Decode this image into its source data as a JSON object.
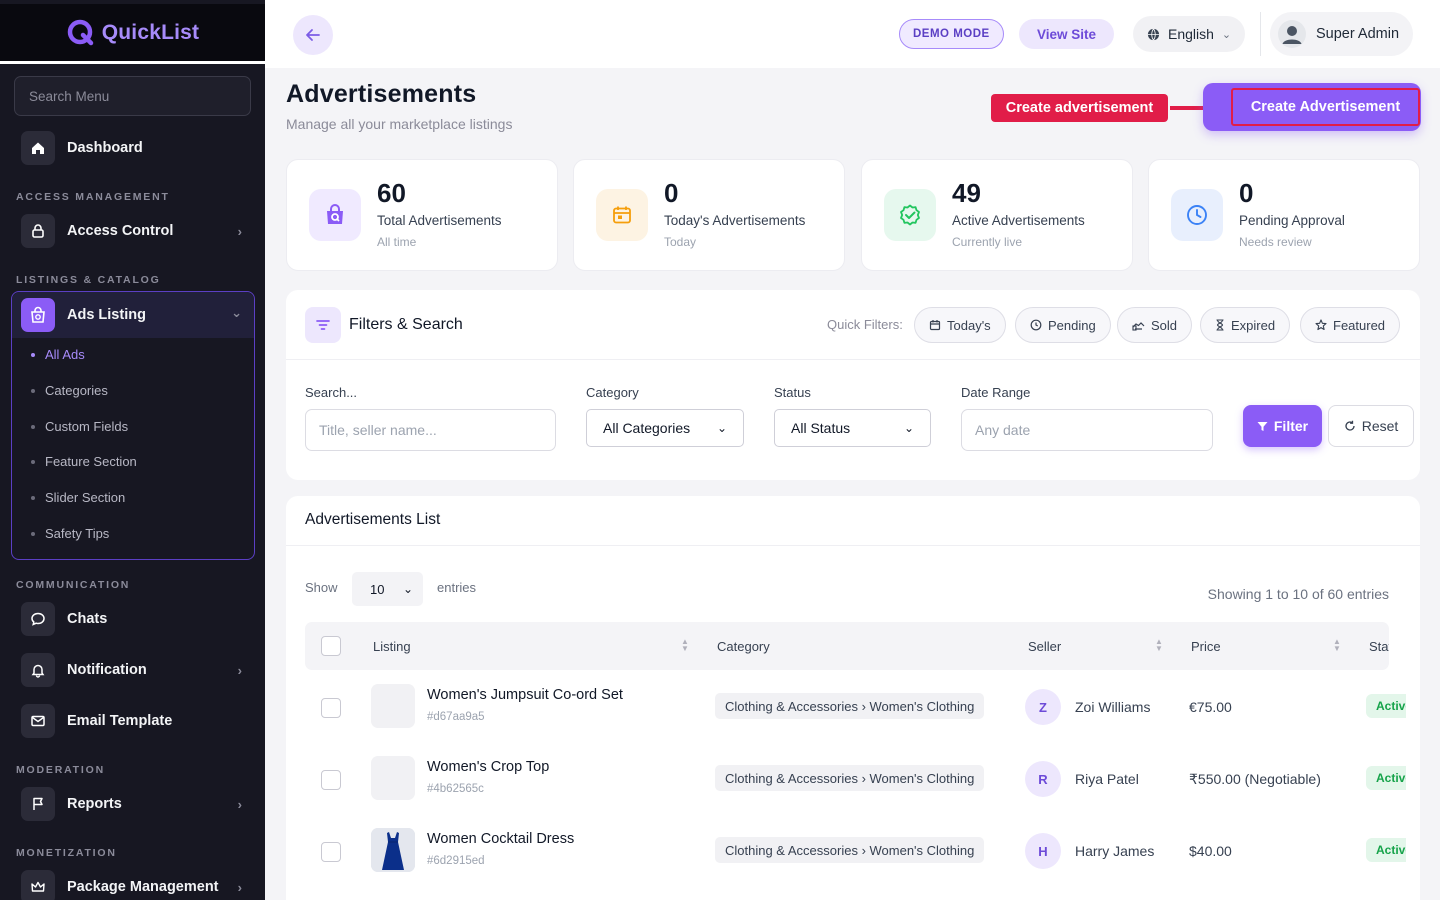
{
  "brand": {
    "name": "QuickList"
  },
  "sidebar": {
    "search_placeholder": "Search Menu",
    "dashboard": "Dashboard",
    "sections": {
      "access": "ACCESS MANAGEMENT",
      "listings": "LISTINGS & CATALOG",
      "communication": "COMMUNICATION",
      "moderation": "MODERATION",
      "monetization": "MONETIZATION"
    },
    "access_control": "Access Control",
    "ads_listing": "Ads Listing",
    "ads_sub": [
      "All Ads",
      "Categories",
      "Custom Fields",
      "Feature Section",
      "Slider Section",
      "Safety Tips"
    ],
    "chats": "Chats",
    "notification": "Notification",
    "email_template": "Email Template",
    "reports": "Reports",
    "package_management": "Package Management"
  },
  "header": {
    "demo_mode": "DEMO MODE",
    "view_site": "View Site",
    "language": "English",
    "user": "Super Admin"
  },
  "page": {
    "title": "Advertisements",
    "subtitle": "Manage all your marketplace listings",
    "create_button": "Create Advertisement",
    "callout": "Create advertisement"
  },
  "stats": [
    {
      "value": "60",
      "label": "Total Advertisements",
      "caption": "All time",
      "color": "#8b5cf6",
      "bg": "#f0eaff",
      "icon": "shopping-bag-search-icon"
    },
    {
      "value": "0",
      "label": "Today's Advertisements",
      "caption": "Today",
      "color": "#f59e0b",
      "bg": "#fdf3e3",
      "icon": "calendar-icon"
    },
    {
      "value": "49",
      "label": "Active Advertisements",
      "caption": "Currently live",
      "color": "#22c55e",
      "bg": "#e6f8ee",
      "icon": "verified-badge-icon"
    },
    {
      "value": "0",
      "label": "Pending Approval",
      "caption": "Needs review",
      "color": "#3b82f6",
      "bg": "#e8effd",
      "icon": "clock-icon"
    }
  ],
  "filters": {
    "title": "Filters & Search",
    "quick_label": "Quick Filters:",
    "quick": [
      "Today's",
      "Pending",
      "Sold",
      "Expired",
      "Featured"
    ],
    "search_label": "Search...",
    "search_placeholder": "Title, seller name...",
    "category_label": "Category",
    "category_value": "All Categories",
    "status_label": "Status",
    "status_value": "All Status",
    "date_label": "Date Range",
    "date_placeholder": "Any date",
    "filter_button": "Filter",
    "reset_button": "Reset"
  },
  "list": {
    "title": "Advertisements List",
    "show": "Show",
    "entries_value": "10",
    "entries": "entries",
    "showing": "Showing 1 to 10 of 60 entries",
    "columns": [
      "Listing",
      "Category",
      "Seller",
      "Price",
      "Status"
    ],
    "rows": [
      {
        "title": "Women's Jumpsuit Co-ord Set",
        "id": "#d67aa9a5",
        "category": "Clothing & Accessories › Women's Clothing",
        "seller_initial": "Z",
        "seller": "Zoi Williams",
        "price": "€75.00",
        "status": "Active",
        "thumb": "blank"
      },
      {
        "title": "Women's Crop Top",
        "id": "#4b62565c",
        "category": "Clothing & Accessories › Women's Clothing",
        "seller_initial": "R",
        "seller": "Riya Patel",
        "price": "₹550.00 (Negotiable)",
        "status": "Active",
        "thumb": "blank"
      },
      {
        "title": "Women Cocktail Dress",
        "id": "#6d2915ed",
        "category": "Clothing & Accessories › Women's Clothing",
        "seller_initial": "H",
        "seller": "Harry James",
        "price": "$40.00",
        "status": "Active",
        "thumb": "dress"
      }
    ]
  },
  "colors": {
    "accent": "#8b5cf6",
    "sidebar_bg": "#171722",
    "callout": "#e11d48"
  }
}
